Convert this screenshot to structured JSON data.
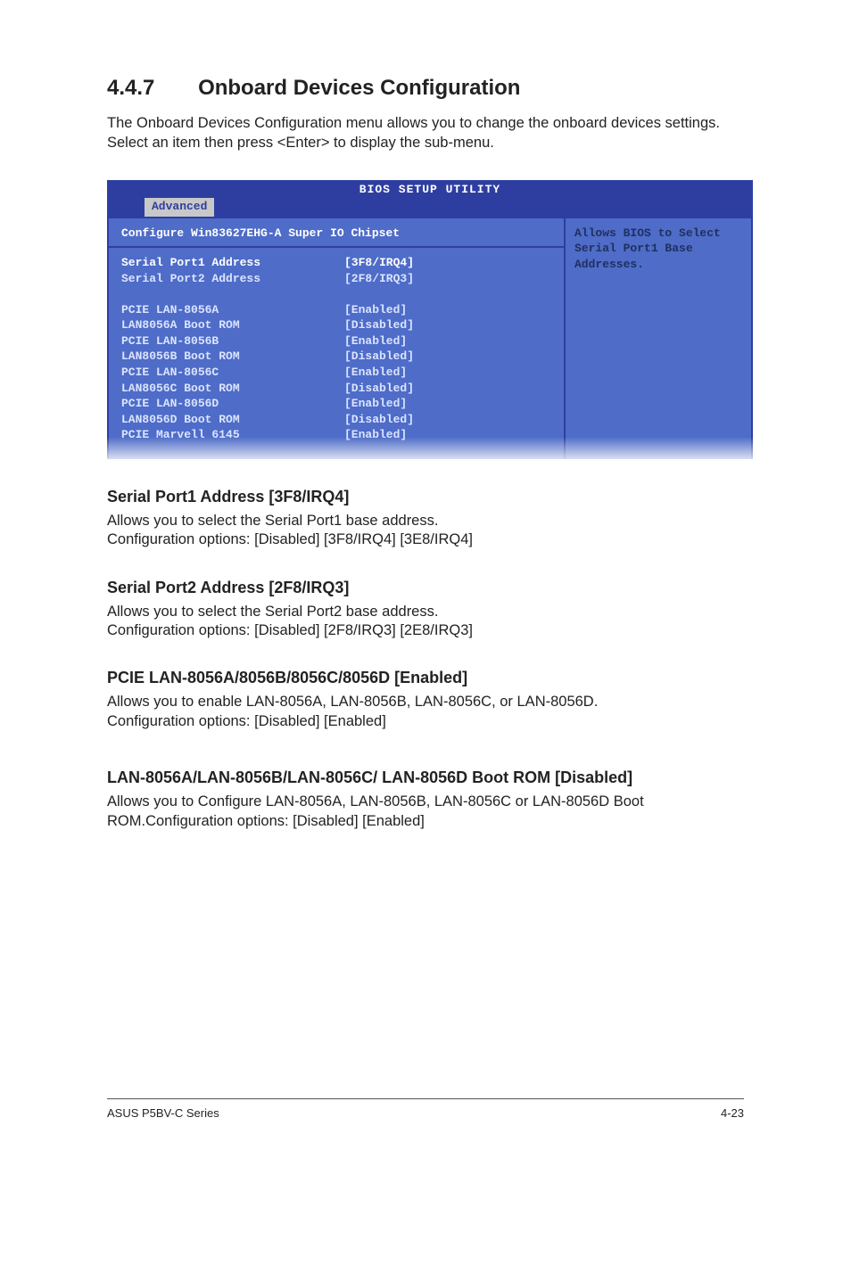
{
  "section": {
    "number": "4.4.7",
    "title": "Onboard Devices Configuration",
    "intro": "The Onboard Devices Configuration menu allows you to change the onboard devices settings. Select an item then press <Enter> to display the sub-menu."
  },
  "bios": {
    "header": "BIOS SETUP UTILITY",
    "tab": "Advanced",
    "heading": "Configure Win83627EHG-A Super IO Chipset",
    "help": "Allows BIOS to Select Serial Port1 Base Addresses.",
    "rows": [
      {
        "label": "Serial Port1 Address",
        "value": "[3F8/IRQ4]",
        "selected": true
      },
      {
        "label": "Serial Port2 Address",
        "value": "[2F8/IRQ3]"
      },
      {
        "label": "",
        "value": ""
      },
      {
        "label": "PCIE LAN-8056A",
        "value": "[Enabled]"
      },
      {
        "label": "LAN8056A Boot ROM",
        "value": "[Disabled]"
      },
      {
        "label": "PCIE LAN-8056B",
        "value": "[Enabled]"
      },
      {
        "label": "LAN8056B Boot ROM",
        "value": "[Disabled]"
      },
      {
        "label": "PCIE LAN-8056C",
        "value": "[Enabled]"
      },
      {
        "label": "LAN8056C Boot ROM",
        "value": "[Disabled]"
      },
      {
        "label": "PCIE LAN-8056D",
        "value": "[Enabled]"
      },
      {
        "label": "LAN8056D Boot ROM",
        "value": "[Disabled]"
      },
      {
        "label": "PCIE Marvell 6145",
        "value": "[Enabled]"
      }
    ]
  },
  "s1": {
    "title": "Serial Port1 Address [3F8/IRQ4]",
    "b1": "Allows you to select the Serial Port1 base address.",
    "b2": "Configuration options: [Disabled] [3F8/IRQ4] [3E8/IRQ4]"
  },
  "s2": {
    "title": "Serial Port2 Address [2F8/IRQ3]",
    "b1": "Allows you to select the Serial Port2 base address.",
    "b2": "Configuration options: [Disabled] [2F8/IRQ3] [2E8/IRQ3]"
  },
  "s3": {
    "title": "PCIE LAN-8056A/8056B/8056C/8056D [Enabled]",
    "b1": "Allows you to enable LAN-8056A, LAN-8056B, LAN-8056C, or LAN-8056D.",
    "b2": "Configuration options: [Disabled] [Enabled]"
  },
  "s4": {
    "title": "LAN-8056A/LAN-8056B/LAN-8056C/ LAN-8056D Boot ROM [Disabled]",
    "b1": "Allows you to Configure LAN-8056A, LAN-8056B, LAN-8056C or LAN-8056D Boot ROM.Configuration options: [Disabled] [Enabled]"
  },
  "footer": {
    "left": "ASUS P5BV-C Series",
    "right": "4-23"
  }
}
